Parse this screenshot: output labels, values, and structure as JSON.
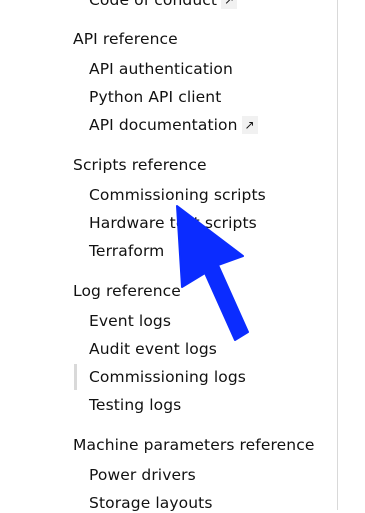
{
  "nav": {
    "partial_top_item": "Code of conduct",
    "groups": [
      {
        "title": "API reference",
        "items": [
          {
            "label": "API authentication"
          },
          {
            "label": "Python API client"
          },
          {
            "label": "API documentation",
            "external": "↗"
          }
        ]
      },
      {
        "title": "Scripts reference",
        "items": [
          {
            "label": "Commissioning scripts"
          },
          {
            "label": "Hardware test scripts"
          },
          {
            "label": "Terraform"
          }
        ]
      },
      {
        "title": "Log reference",
        "items": [
          {
            "label": "Event logs"
          },
          {
            "label": "Audit event logs"
          },
          {
            "label": "Commissioning logs",
            "active": true
          },
          {
            "label": "Testing logs"
          }
        ]
      },
      {
        "title": "Machine parameters reference",
        "items": [
          {
            "label": "Power drivers"
          },
          {
            "label": "Storage layouts"
          }
        ]
      }
    ],
    "external_icon": "↗"
  },
  "overlay": {
    "pointer_icon": "arrow-pointer-icon",
    "pointer_color": "#0b2cff"
  }
}
